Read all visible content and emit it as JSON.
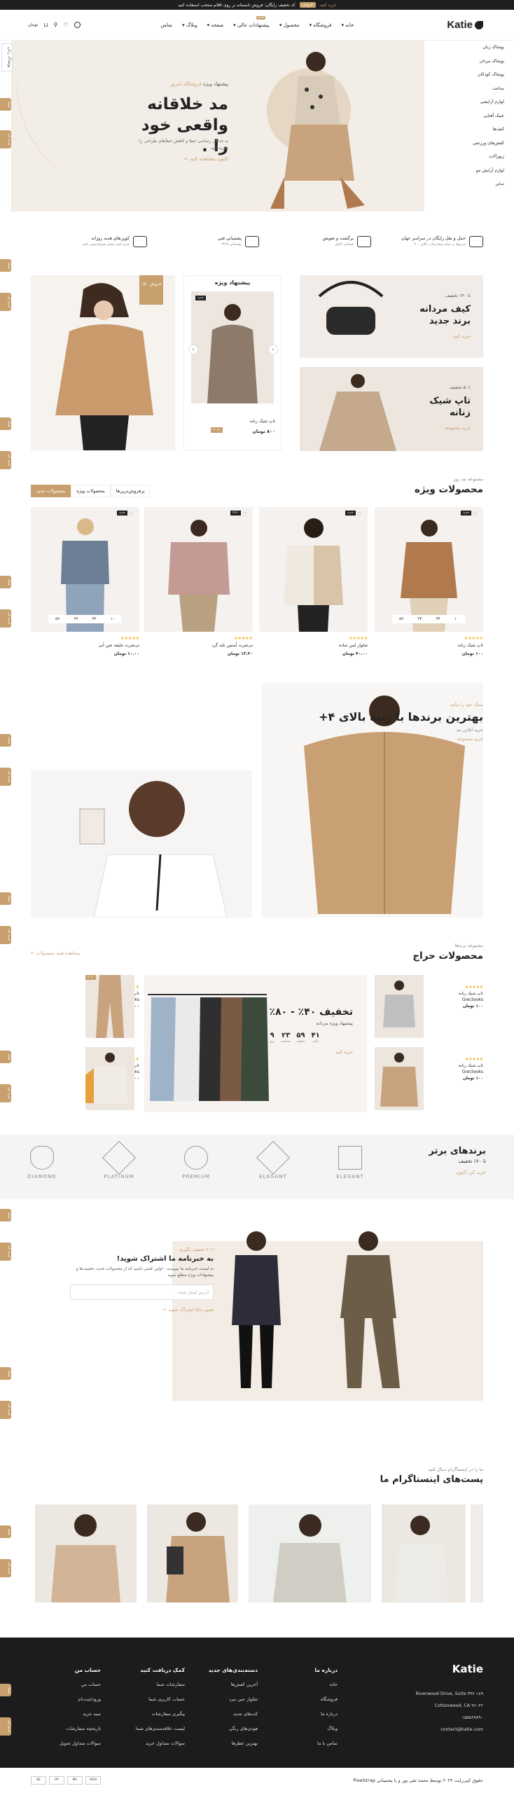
{
  "topbar": {
    "text": "کد تخفیف رایگان: فروش تابستانه بر روی اقلام منتخب استفاده کنید",
    "code": "فروش",
    "cta": "خرید کنید"
  },
  "header": {
    "logo": "Katie",
    "nav": [
      "خانه",
      "فروشگاه",
      "محصول",
      "پیشنهادات عالی",
      "صفحه",
      "وبلاگ",
      "تماس"
    ],
    "nav_new": "جدید",
    "currency": "تومان",
    "cart_count": "۰",
    "wish_count": "۰"
  },
  "sidebar": [
    "پوشاک زنان",
    "پوشاک مردان",
    "پوشاک کودکان",
    "ساعت",
    "لوازم آرایشی",
    "عینک آفتابی",
    "کیف‌ها",
    "کفش‌های ورزشی",
    "زیورآلات",
    "لوازم آرایش مو",
    "سایر"
  ],
  "hero": {
    "small": "پیشنهاد ویژه",
    "small_accent": "فروشگاه امروز",
    "title": "مد خلاقانه واقعی خود را .",
    "desc": "به حداقل رساندن خطا و کاهش خطاهای طراحی را تجربه کنید",
    "button": "اکنون مشاهده کنید"
  },
  "features": [
    {
      "title": "حمل و نقل رایگان در سراسر جهان",
      "sub": "مربوط به تمام سفارشات بالای ۴۰۰"
    },
    {
      "title": "برگشت و تعویض",
      "sub": "ضمانت کامل"
    },
    {
      "title": "پشتیبانی فنی",
      "sub": "پشتیبانی ۲۴/۷"
    },
    {
      "title": "کوپن‌های هدیه روزانه",
      "sub": "خرید کنید بیشتر صرفه‌جویی کنید"
    }
  ],
  "left_card": {
    "tag": "فروش ۵۰٪"
  },
  "special": {
    "title": "پیشنهاد ویژه",
    "name": "تاپ شیک زنانه",
    "price": "۸۰۰ تومان",
    "old": "۹۰۰ تومان",
    "sale": "-۲۰٪",
    "new": "جدید"
  },
  "promo1": {
    "pct": "تا ۴۰٪ تخفیف",
    "title": "کیف مردانه برند جدید",
    "link": "خرید کنید"
  },
  "promo2": {
    "pct": "۵۰٪ تخفیف",
    "title": "تاپ شیک زنانه",
    "link": "خرید مجموعه"
  },
  "products_sec": {
    "sub": "مجموعه مد روز",
    "title": "محصولات ویژه",
    "tabs": [
      "محصولات جدید",
      "محصولات ویژه",
      "پرفروش‌ترین‌ها"
    ]
  },
  "products": [
    {
      "name": "تاپ شیک زنانه",
      "price": "۱۰۰ تومان",
      "old": "۱۲۰ تومان",
      "badge": "جدید"
    },
    {
      "name": "شلوار لینن ساده",
      "price": "۴۰.۰۰ تومان",
      "old": "",
      "badge": "جدید"
    },
    {
      "name": "تی‌شرت آستین بلند گرد",
      "price": "۱۳.۳۰ تومان",
      "old": "۱۸.۰۰",
      "badge": "-۲۶٪"
    },
    {
      "name": "تی‌شرت جلیقه جین آبی",
      "price": "۱۰.۰۰ تومان",
      "old": "۱۴.۰۰",
      "badge": "جدید"
    }
  ],
  "countdown": {
    "d": "۵۹",
    "h": "۲۳",
    "m": "۳۴",
    "s": "۱۰"
  },
  "banner2": {
    "kicker": "سبک خود را بیابید",
    "title": "بهترین برندها با رتبه بالای ۴+",
    "sub": "خرید آنلاین مد",
    "link": "خرید مجموعه"
  },
  "sale_sec": {
    "sub": "مجموعه برندها",
    "title": "محصولات حراج",
    "link": "مشاهده همه محصولات"
  },
  "mini": {
    "name": "تاپ شیک زنانه",
    "brand": "Grecilooks",
    "price": "۱۰۰ تومان",
    "badge": "-۲۰٪"
  },
  "deal": {
    "title": "تخفیف ۴۰٪ - ۸۰٪",
    "sub": "پیشنهاد ویژه مردانه",
    "labels": [
      "ثانیه",
      "دقیقه",
      "ساعت",
      "روز"
    ],
    "nums": [
      "۴۱",
      "۵۹",
      "۲۳",
      "۹"
    ],
    "link": "خرید کنید"
  },
  "brands": {
    "title": "برندهای برتر",
    "sub": "تا ۶۰٪ تخفیف",
    "link": "خرید کن اکنون",
    "names": [
      "ELEGANT",
      "ELEGANT",
      "PREMIUM",
      "PLATINUM",
      "DIAMOND"
    ]
  },
  "newsletter": {
    "kicker": "۲۰٪ تخفیف بگیرید",
    "title": "به خبرنامه ما اشتراک شوید!",
    "desc": "به لیست خبرنامه ما بپیوندید - اولین کسی باشید که از محصولات جدید، تخفیف‌ها و پیشنهادات ویژه مطلع شوید",
    "placeholder": "آدرس ایمیل شما...",
    "link": "همین حالا اشتراک شوید"
  },
  "insta": {
    "kicker": "ما را در اینستاگرام دنبال کنید",
    "title": "پست‌های اینستاگرام ما"
  },
  "footer": {
    "logo": "Katie",
    "address": "Riverwood Drive, Suite ۳۳۶ ۱۸۹",
    "city": "Cottonwood, CA ۹۶۰۲۲",
    "phone": "۱۵۵۵۶۷۸۹۰",
    "email": "contact@katie.com",
    "cols": [
      {
        "title": "درباره ما",
        "items": [
          "خانه",
          "فروشگاه",
          "درباره ما",
          "وبلاگ",
          "تماس با ما"
        ]
      },
      {
        "title": "دسته‌بندی‌های جدید",
        "items": [
          "آخرین کفش‌ها",
          "شلوار جین مرد",
          "کت‌های جدید",
          "هودی‌های رنگی",
          "بهترین عطرها"
        ]
      },
      {
        "title": "کمک دریافت کنید",
        "items": [
          "سفارشات شما",
          "حساب کاربری شما",
          "پیگیری سفارشات",
          "لیست علاقه‌مندی‌های شما",
          "سوالات متداول خرید"
        ]
      },
      {
        "title": "حساب من",
        "items": [
          "حساب من",
          "ورود/ثبت‌نام",
          "سبد خرید",
          "تاریخچه سفارشات",
          "سوالات متداول تحویل"
        ]
      }
    ],
    "copyright": "حقوق کپی‌رایت ۲۰۲۴ توسط محمد تقی پور و با پشتیبانی Pixelstrap"
  },
  "sticky": [
    "شیک",
    "خرید کن"
  ],
  "colors": {
    "accent": "#c8a06e",
    "dark": "#1c1c1c"
  }
}
